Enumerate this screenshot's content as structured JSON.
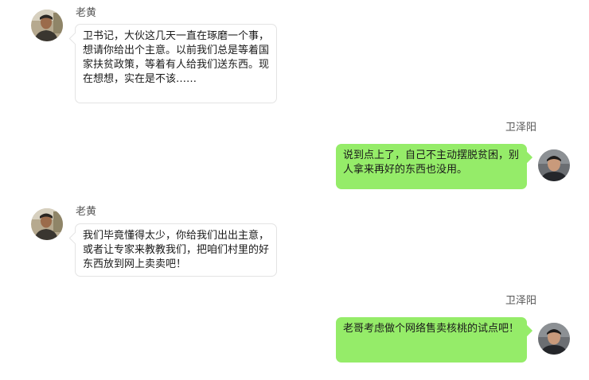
{
  "conversation": {
    "messages": [
      {
        "side": "left",
        "sender": "老黄",
        "text": "卫书记，大伙这几天一直在琢磨一个事，想请你给出个主意。以前我们总是等着国家扶贫政策，等着有人给我们送东西。现在想想，实在是不该……"
      },
      {
        "side": "right",
        "sender": "卫泽阳",
        "text": "说到点上了，自己不主动摆脱贫困，别人拿来再好的东西也没用。"
      },
      {
        "side": "left",
        "sender": "老黄",
        "text": "我们毕竟懂得太少，你给我们出出主意，或者让专家来教教我们，把咱们村里的好东西放到网上卖卖吧！"
      },
      {
        "side": "right",
        "sender": "卫泽阳",
        "text": "老哥考虑做个网络售卖核桃的试点吧！"
      }
    ]
  },
  "colors": {
    "page_background": "#ffffff",
    "outgoing_bubble": "#95ec69",
    "incoming_bubble": "#ffffff",
    "incoming_bubble_border": "#e3e3e3",
    "sender_name": "#555555",
    "message_text": "#1a1a1a"
  },
  "icons": {
    "incoming_avatar": "avatar-laohuang-icon",
    "outgoing_avatar": "avatar-weizeyang-icon"
  }
}
